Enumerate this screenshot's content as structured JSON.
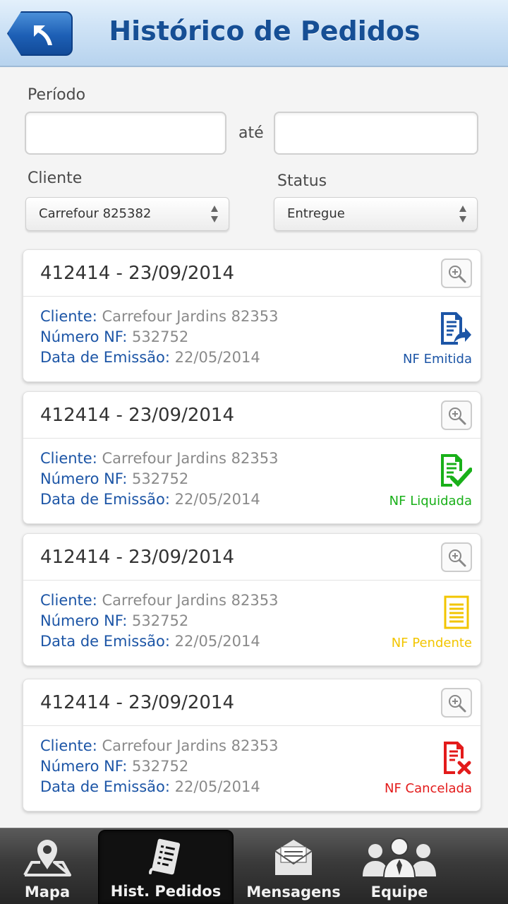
{
  "header": {
    "title": "Histórico de Pedidos"
  },
  "filters": {
    "period_label": "Período",
    "period_start": "",
    "period_separator": "até",
    "period_end": "",
    "client_label": "Cliente",
    "client_value": "Carrefour 825382",
    "status_label": "Status",
    "status_value": "Entregue"
  },
  "orders": [
    {
      "title": "412414 - 23/09/2014",
      "client_key": "Cliente:",
      "client": "Carrefour Jardins 82353",
      "nf_key": "Número NF:",
      "nf": "532752",
      "date_key": "Data de Emissão:",
      "date": "22/05/2014",
      "status": "NF Emitida",
      "status_icon": "document-send-icon",
      "status_color": "#1c55a6"
    },
    {
      "title": "412414 - 23/09/2014",
      "client_key": "Cliente:",
      "client": "Carrefour Jardins 82353",
      "nf_key": "Número NF:",
      "nf": "532752",
      "date_key": "Data de Emissão:",
      "date": "22/05/2014",
      "status": "NF Liquidada",
      "status_icon": "document-check-icon",
      "status_color": "#19b019"
    },
    {
      "title": "412414 - 23/09/2014",
      "client_key": "Cliente:",
      "client": "Carrefour Jardins 82353",
      "nf_key": "Número NF:",
      "nf": "532752",
      "date_key": "Data de Emissão:",
      "date": "22/05/2014",
      "status": "NF Pendente",
      "status_icon": "document-pending-icon",
      "status_color": "#f2c500"
    },
    {
      "title": "412414 - 23/09/2014",
      "client_key": "Cliente:",
      "client": "Carrefour Jardins 82353",
      "nf_key": "Número NF:",
      "nf": "532752",
      "date_key": "Data de Emissão:",
      "date": "22/05/2014",
      "status": "NF Cancelada",
      "status_icon": "document-cancel-icon",
      "status_color": "#e31b1b"
    }
  ],
  "nav": {
    "items": [
      {
        "label": "Mapa",
        "icon": "map-pin-icon"
      },
      {
        "label": "Hist. Pedidos",
        "icon": "order-history-icon",
        "active": true
      },
      {
        "label": "Mensagens",
        "icon": "envelope-icon"
      },
      {
        "label": "Equipe",
        "icon": "team-icon"
      }
    ]
  }
}
